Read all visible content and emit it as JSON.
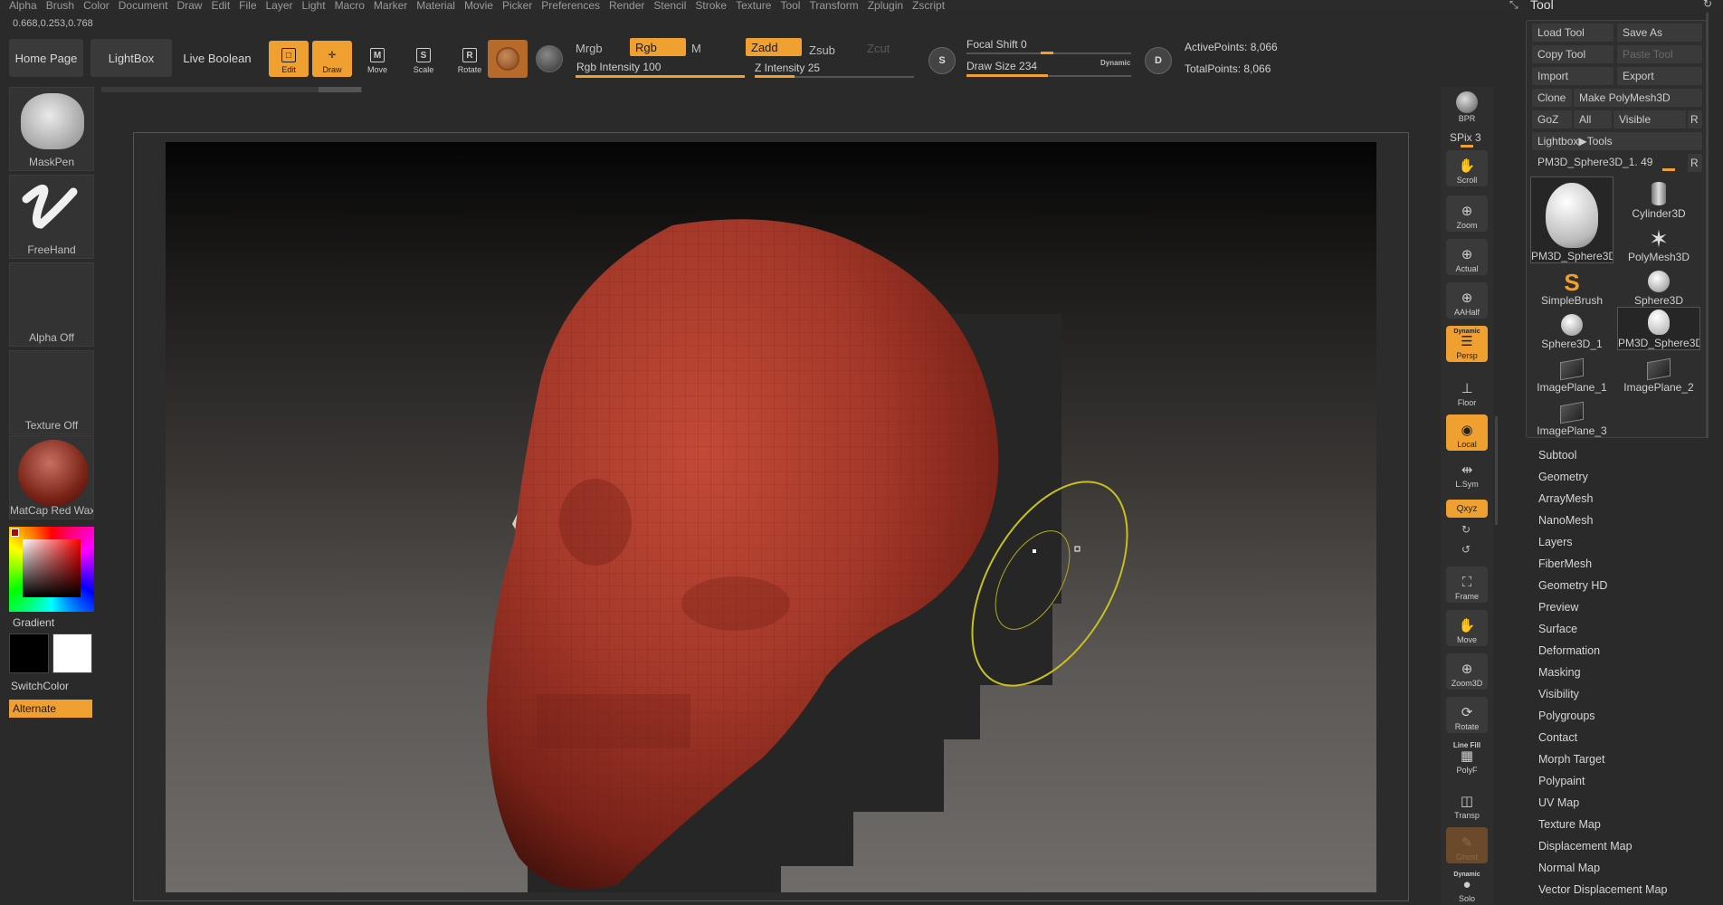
{
  "menu": [
    "Alpha",
    "Brush",
    "Color",
    "Document",
    "Draw",
    "Edit",
    "File",
    "Layer",
    "Light",
    "Macro",
    "Marker",
    "Material",
    "Movie",
    "Picker",
    "Preferences",
    "Render",
    "Stencil",
    "Stroke",
    "Texture",
    "Tool",
    "Transform",
    "Zplugin",
    "Zscript"
  ],
  "coords": "0.668,0.253,0.768",
  "palette_title": "Tool",
  "top_tabs": {
    "home": "Home Page",
    "lightbox": "LightBox",
    "live_boolean": "Live Boolean"
  },
  "tools": {
    "edit": "Edit",
    "draw": "Draw",
    "move": "Move",
    "scale": "Scale",
    "rotate": "Rotate"
  },
  "color_mode": {
    "mrgb": "Mrgb",
    "rgb": "Rgb",
    "m": "M",
    "rgb_intensity": "Rgb Intensity 100"
  },
  "z_mode": {
    "zadd": "Zadd",
    "zsub": "Zsub",
    "zcut": "Zcut",
    "z_intensity": "Z Intensity 25"
  },
  "focal_shift": "Focal Shift 0",
  "draw_size": "Draw Size 234",
  "dynamic": "Dynamic",
  "points": {
    "active": "ActivePoints: 8,066",
    "total": "TotalPoints: 8,066"
  },
  "left_shelf": {
    "brush": "MaskPen",
    "stroke": "FreeHand",
    "alpha": "Alpha Off",
    "texture": "Texture Off",
    "material": "MatCap Red Wax",
    "gradient": "Gradient",
    "switch_color": "SwitchColor",
    "alternate": "Alternate"
  },
  "right_shelf": {
    "bpr": "BPR",
    "spix": "SPix 3",
    "scroll": "Scroll",
    "zoom": "Zoom",
    "actual": "Actual",
    "aahalf": "AAHalf",
    "dynamic": "Dynamic",
    "persp": "Persp",
    "floor": "Floor",
    "local": "Local",
    "lsym": "L.Sym",
    "xyz": "Qxyz",
    "frame": "Frame",
    "move": "Move",
    "zoom3d": "Zoom3D",
    "rotate": "Rotate",
    "line_fill": "Line Fill",
    "polyf": "PolyF",
    "transp": "Transp",
    "ghost": "Ghost",
    "solo_dynamic": "Dynamic",
    "solo": "Solo"
  },
  "tool_palette": {
    "load_tool": "Load Tool",
    "save_as": "Save As",
    "copy_tool": "Copy Tool",
    "paste_tool": "Paste Tool",
    "import": "Import",
    "export": "Export",
    "clone": "Clone",
    "make_polymesh": "Make PolyMesh3D",
    "goz": "GoZ",
    "all": "All",
    "visible": "Visible",
    "r": "R",
    "lightbox_tools": "Lightbox▶Tools",
    "current_tool": "PM3D_Sphere3D_1. 49",
    "thumbnails": [
      "PM3D_Sphere3D",
      "Cylinder3D",
      "PolyMesh3D",
      "SimpleBrush",
      "Sphere3D",
      "Sphere3D_1",
      "PM3D_Sphere3D",
      "ImagePlane_1",
      "ImagePlane_2",
      "ImagePlane_3"
    ]
  },
  "subpalettes": [
    "Subtool",
    "Geometry",
    "ArrayMesh",
    "NanoMesh",
    "Layers",
    "FiberMesh",
    "Geometry HD",
    "Preview",
    "Surface",
    "Deformation",
    "Masking",
    "Visibility",
    "Polygroups",
    "Contact",
    "Morph Target",
    "Polypaint",
    "UV Map",
    "Texture Map",
    "Displacement Map",
    "Normal Map",
    "Vector Displacement Map"
  ],
  "colors": {
    "accent": "#f0a030",
    "skull": "#a3382a",
    "brush_ring": "#c8c020"
  }
}
